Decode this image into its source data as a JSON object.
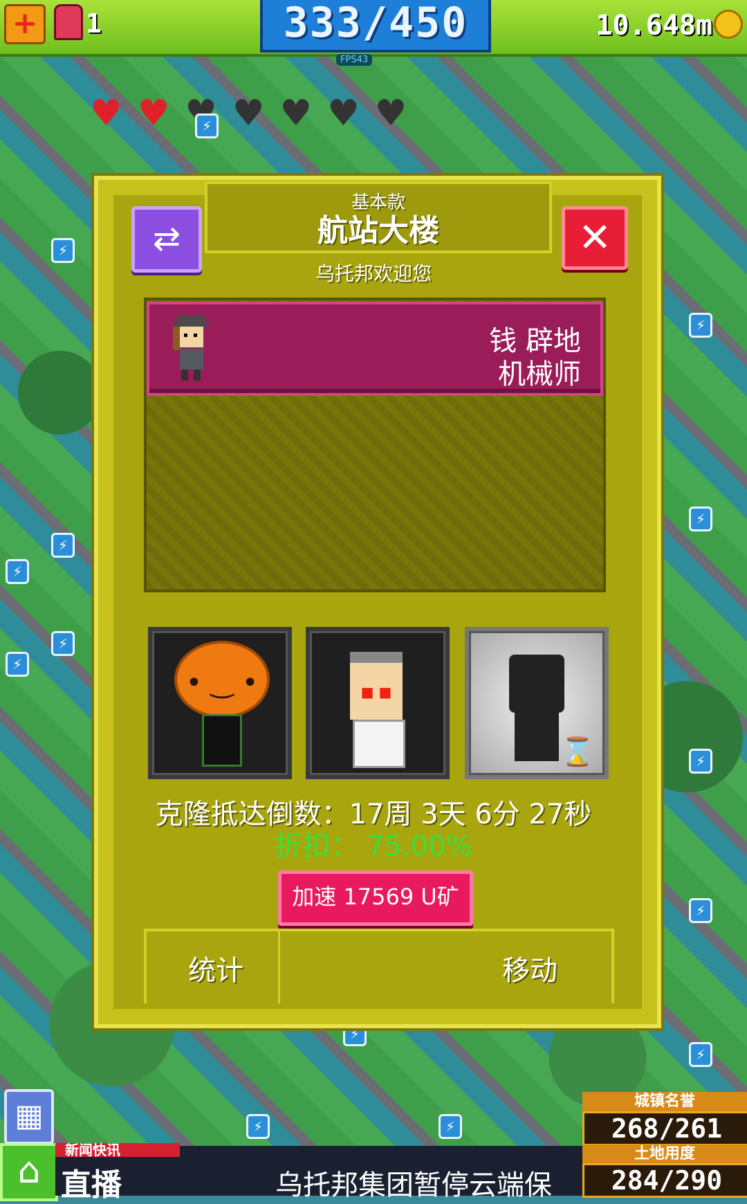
{
  "hud": {
    "alarm_count": "1",
    "population": "333/450",
    "fps": "FPS43",
    "money": "10.648m"
  },
  "dialog": {
    "building_type": "基本款",
    "building_name": "航站大楼",
    "welcome": "乌托邦欢迎您",
    "resident": {
      "name": "钱 辟地",
      "job": "机械师"
    },
    "clone_countdown": "克隆抵达倒数：17周 3天 6分 27秒",
    "discount": "折扣：  75.00%",
    "speedup_label": "加速 17569 U矿",
    "tabs": {
      "stats": "统计",
      "move": "移动"
    }
  },
  "bottom": {
    "city_fame_label": "城镇名誉",
    "city_fame_value": "268/261",
    "land_use_label": "土地用度",
    "land_use_value": "284/290",
    "news_tag": "新闻快讯",
    "news_live": "直播",
    "news_text": "乌托邦集团暂停云端保"
  },
  "colors": {
    "panel": "#c6c21b",
    "resident_bar": "#9a1c58",
    "close": "#e81d36",
    "swap": "#8a4ee0",
    "speedup": "#e8195e",
    "discount_text": "#38e03a"
  },
  "icons": {
    "medkit": "medkit-icon",
    "alarm": "alarm-icon",
    "coin": "coin-icon",
    "swap": "swap-icon",
    "close": "close-icon",
    "hourglass": "hourglass-icon",
    "calendar": "calendar-icon",
    "home": "home-icon"
  }
}
